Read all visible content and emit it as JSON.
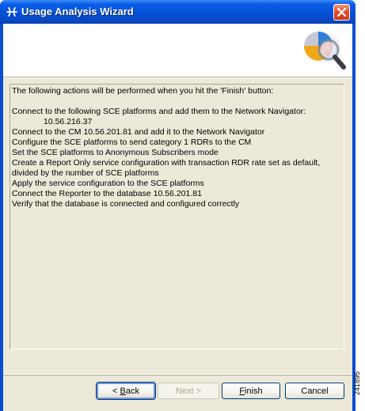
{
  "window": {
    "title": "Usage Analysis Wizard",
    "icons": {
      "app": "wizard-app-icon",
      "close": "close-icon",
      "header": "pie-chart-magnifier-icon"
    }
  },
  "content": {
    "intro": "The following actions will be performed when you hit the 'Finish' button:",
    "actions": [
      "Connect to the following SCE platforms and add them to the Network Navigator:",
      "10.56.216.37",
      "Connect to the CM 10.56.201.81 and add it to the Network Navigator",
      "Configure the SCE platforms to send category 1 RDRs to the CM",
      "Set the SCE platforms to Anonymous Subscribers mode",
      "Create a Report Only service configuration with transaction RDR rate set as default,",
      "divided by the number of SCE platforms",
      "Apply the service configuration to the SCE platforms",
      "Connect the Reporter to the database 10.56.201.81",
      "Verify that the database is connected and configured correctly"
    ]
  },
  "buttons": {
    "back_prefix": "< ",
    "back_mnemonic": "B",
    "back_rest": "ack",
    "next_prefix": "Next >",
    "finish_mnemonic": "F",
    "finish_rest": "inish",
    "cancel": "Cancel"
  },
  "figure_number": "241895",
  "colors": {
    "title_bar": "#0551d6",
    "client_bg": "#ece9d8",
    "close_button": "#e0512e"
  }
}
